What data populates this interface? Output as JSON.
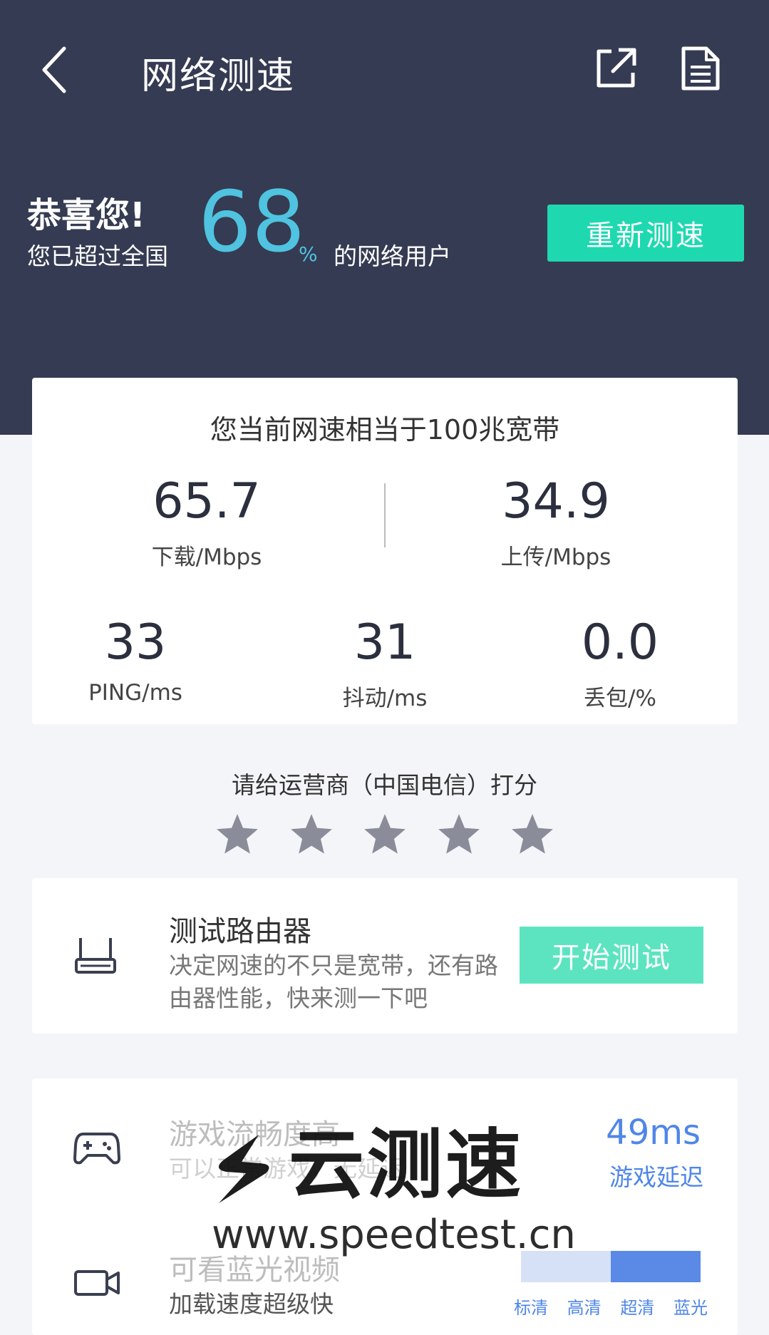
{
  "header": {
    "title": "网络测速",
    "congrats": "恭喜您!",
    "exceed_prefix": "您已超过全国",
    "percentile": "68",
    "percent_sign": "%",
    "exceed_suffix": "的网络用户",
    "retest_label": "重新测速",
    "icons": [
      "back-icon",
      "share-icon",
      "report-icon"
    ]
  },
  "speed": {
    "equivalent": "您当前网速相当于100兆宽带",
    "download": {
      "value": "65.7",
      "label": "下载/Mbps"
    },
    "upload": {
      "value": "34.9",
      "label": "上传/Mbps"
    },
    "ping": {
      "value": "33",
      "label": "PING/ms"
    },
    "jitter": {
      "value": "31",
      "label": "抖动/ms"
    },
    "loss": {
      "value": "0.0",
      "label": "丢包/%"
    }
  },
  "rating": {
    "title": "请给运营商（中国电信）打分",
    "stars": 5,
    "star_color": "#8a8d99"
  },
  "router": {
    "title": "测试路由器",
    "desc": "决定网速的不只是宽带，还有路由器性能，快来测一下吧",
    "button": "开始测试"
  },
  "game": {
    "title": "游戏流畅度高",
    "desc": "可以正常游戏，无延迟",
    "latency": "49ms",
    "latency_label": "游戏延迟"
  },
  "video": {
    "title": "可看蓝光视频",
    "desc": "加载速度超级快",
    "quality_labels": [
      "标清",
      "高清",
      "超清",
      "蓝光"
    ],
    "quality_level": "超清"
  },
  "watermark": {
    "text": "云测速",
    "url": "www.speedtest.cn"
  },
  "colors": {
    "header_bg": "#353b52",
    "accent": "#4fc3e0",
    "retest_bg": "#1ed9b0",
    "start_bg": "#5ce4c0",
    "blue": "#4f86e8"
  }
}
